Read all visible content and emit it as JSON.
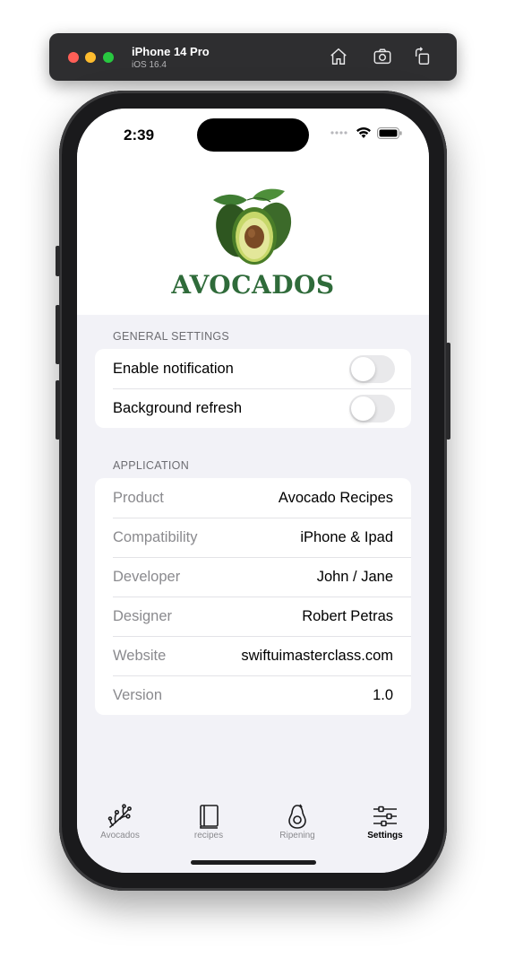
{
  "simulator": {
    "device": "iPhone 14 Pro",
    "os": "iOS 16.4",
    "buttons": [
      "home-icon",
      "screenshot-icon",
      "rotate-icon"
    ]
  },
  "status_bar": {
    "time": "2:39"
  },
  "header": {
    "brand": "AVOCADOS"
  },
  "general_settings": {
    "title": "GENERAL SETTINGS",
    "rows": [
      {
        "label": "Enable notification",
        "enabled": false
      },
      {
        "label": "Background refresh",
        "enabled": false
      }
    ]
  },
  "application": {
    "title": "APPLICATION",
    "rows": [
      {
        "key": "Product",
        "value": "Avocado Recipes"
      },
      {
        "key": "Compatibility",
        "value": "iPhone & Ipad"
      },
      {
        "key": "Developer",
        "value": "John / Jane"
      },
      {
        "key": "Designer",
        "value": "Robert Petras"
      },
      {
        "key": "Website",
        "value": "swiftuimasterclass.com"
      },
      {
        "key": "Version",
        "value": "1.0"
      }
    ]
  },
  "tabs": [
    {
      "label": "Avocados",
      "icon": "branch-icon",
      "active": false
    },
    {
      "label": "recipes",
      "icon": "book-icon",
      "active": false
    },
    {
      "label": "Ripening",
      "icon": "avocado-icon",
      "active": false
    },
    {
      "label": "Settings",
      "icon": "sliders-icon",
      "active": true
    }
  ],
  "colors": {
    "brand_green": "#2f6b3a",
    "background": "#f2f2f7",
    "toggle_off": "#e9e9eb"
  }
}
